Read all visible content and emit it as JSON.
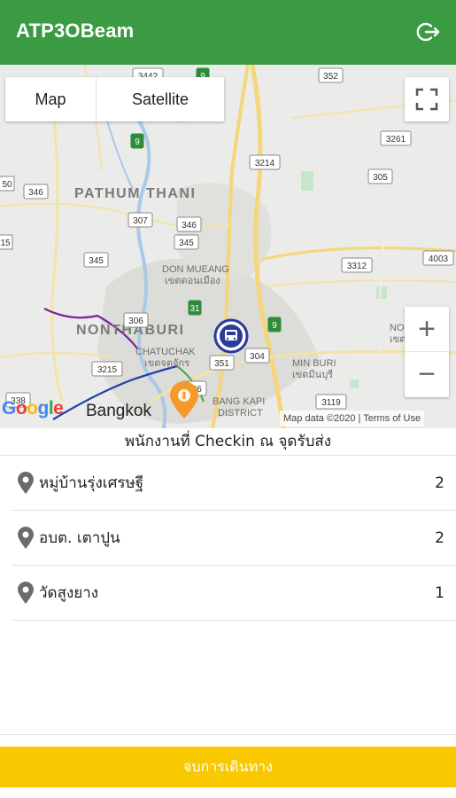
{
  "appbar": {
    "title": "ATP3OBeam",
    "logout_icon": "logout-icon",
    "color": "#3a9b43"
  },
  "map": {
    "type_buttons": {
      "map": "Map",
      "satellite": "Satellite"
    },
    "zoom": {
      "in": "+",
      "out": "−"
    },
    "attribution": "Map data ©2020 | Terms of Use",
    "labels": {
      "pathum_thani": "PATHUM THANI",
      "nonthaburi": "NONTHABURI",
      "don_mueang": "DON MUEANG",
      "don_mueang_th": "เขตดอนเมือง",
      "chatuchak": "CHATUCHAK",
      "chatuchak_th": "เขตจตุจักร",
      "min_buri": "MIN BURI",
      "min_buri_th": "เขตมีนบุรี",
      "bang_kapi": "BANG KAPI",
      "bang_kapi_2": "DISTRICT",
      "bangkok": "Bangkok",
      "no_right": "NO",
      "no_right_th": "เขต"
    },
    "road_shields": [
      "3442",
      "352",
      "9",
      "9",
      "3261",
      "3214",
      "305",
      "346",
      "307",
      "346",
      "345",
      "3312",
      "4003",
      "345",
      "31",
      "9",
      "306",
      "304",
      "351",
      "3215",
      "338",
      "336",
      "3119"
    ],
    "shield_partial_left": {
      "a": "50",
      "b": "15"
    }
  },
  "sheet": {
    "title": "พนักงานที่ Checkin ณ จุดรับส่ง",
    "items": [
      {
        "name": "หมู่บ้านรุ่งเศรษฐี",
        "count": "2"
      },
      {
        "name": "อบต. เตาปูน",
        "count": "2"
      },
      {
        "name": "วัดสูงยาง",
        "count": "1"
      }
    ]
  },
  "end_button": {
    "label": "จบการเดินทาง",
    "color": "#f8c800"
  }
}
